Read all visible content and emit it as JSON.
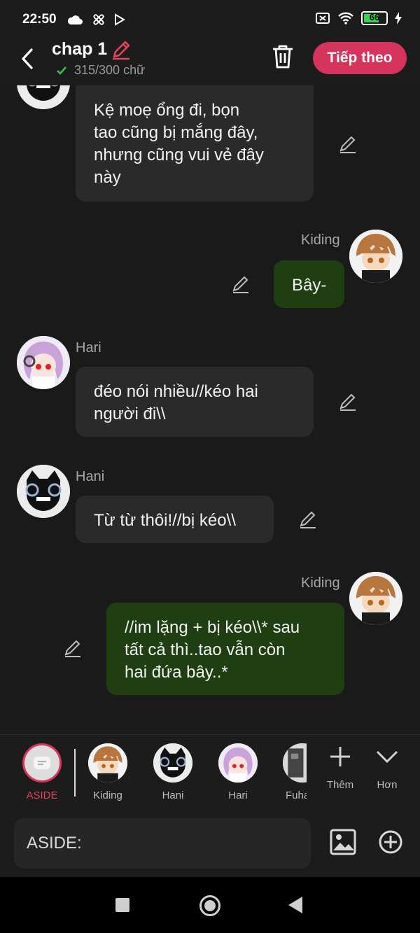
{
  "status_bar": {
    "time": "22:50",
    "battery": "66"
  },
  "header": {
    "title": "chap 1",
    "word_count": "315/300 chữ",
    "next_label": "Tiếp theo"
  },
  "messages": [
    {
      "text": "Kệ moẹ ổng đi, bọn\ntao cũng bị mắng đây,\nnhưng cũng vui vẻ đây\nnày"
    },
    {
      "name": "Kiding",
      "text": "Bây-"
    },
    {
      "name": "Hari",
      "text": "đéo nói nhiều//kéo hai\nngười đi\\\\"
    },
    {
      "name": "Hani",
      "text": "Từ từ thôi!//bị kéo\\\\"
    },
    {
      "name": "Kiding",
      "text": "//im lặng + bị kéo\\\\* sau\ntất cả thì..tao vẫn còn\nhai đứa bây..*"
    }
  ],
  "characters": [
    {
      "label": "ASIDE"
    },
    {
      "label": "Kiding"
    },
    {
      "label": "Hani"
    },
    {
      "label": "Hari"
    },
    {
      "label": "Fuha"
    }
  ],
  "tools": {
    "add_label": "Thêm",
    "more_label": "Hơn"
  },
  "input": {
    "text": "ASIDE:"
  },
  "colors": {
    "accent": "#d6335d",
    "mine_bubble": "#1f3f12",
    "other_bubble": "#2a2a2a",
    "background": "#1a1a1a"
  }
}
